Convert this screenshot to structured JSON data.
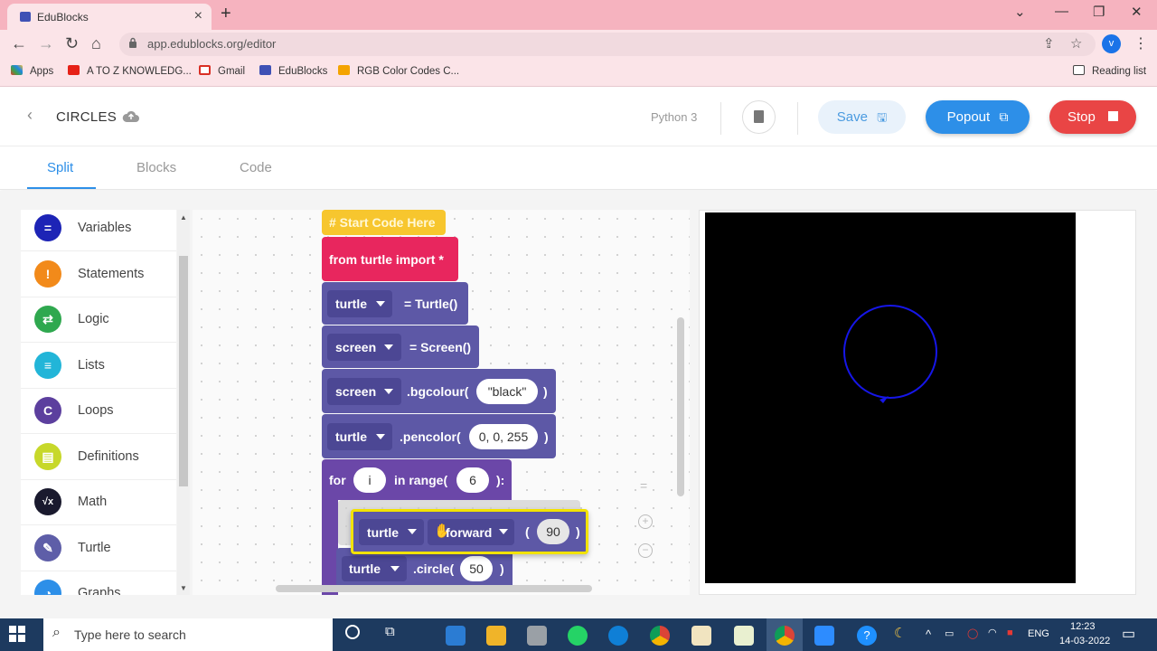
{
  "browser": {
    "tab_title": "EduBlocks",
    "url": "app.edublocks.org/editor",
    "avatar_letter": "v",
    "bookmarks": [
      "Apps",
      "A TO Z KNOWLEDG...",
      "Gmail",
      "EduBlocks",
      "RGB Color Codes C..."
    ],
    "reading_list": "Reading list"
  },
  "header": {
    "project_title": "CIRCLES",
    "language": "Python 3",
    "save_label": "Save",
    "popout_label": "Popout",
    "stop_label": "Stop"
  },
  "view_tabs": [
    "Split",
    "Blocks",
    "Code"
  ],
  "categories": [
    {
      "label": "Variables",
      "color": "#1d24b6",
      "glyph": "="
    },
    {
      "label": "Statements",
      "color": "#f28a1a",
      "glyph": "!"
    },
    {
      "label": "Logic",
      "color": "#2fa84f",
      "glyph": "⇄"
    },
    {
      "label": "Lists",
      "color": "#22b5d8",
      "glyph": "≡"
    },
    {
      "label": "Loops",
      "color": "#5c3f9e",
      "glyph": "C"
    },
    {
      "label": "Definitions",
      "color": "#c7d82a",
      "glyph": "▤"
    },
    {
      "label": "Math",
      "color": "#1a1a2e",
      "glyph": "√x"
    },
    {
      "label": "Turtle",
      "color": "#5e5ea8",
      "glyph": "✎"
    },
    {
      "label": "Graphs",
      "color": "#2d8fe8",
      "glyph": "◔"
    }
  ],
  "blocks": {
    "start": "# Start Code Here",
    "import": "from turtle import *",
    "turtle_var": "turtle",
    "turtle_assign": "= Turtle()",
    "screen_var": "screen",
    "screen_assign": "= Screen()",
    "bgcolour_call": ".bgcolour(",
    "bgcolour_value": "\"black\"",
    "pencolor_call": ".pencolor(",
    "pencolor_value": "0, 0, 255",
    "close_paren": ")",
    "for_kw": "for",
    "for_var": "i",
    "in_range": "in range(",
    "range_value": "6",
    "range_close": "):",
    "forward_method": "forward",
    "open_paren": "(",
    "forward_value": "90",
    "circle_call": ".circle(",
    "circle_value": "50"
  },
  "output": {
    "background": "#000000",
    "pen_color": "#0000ff"
  },
  "taskbar": {
    "search_placeholder": "Type here to search",
    "language": "ENG",
    "time": "12:23",
    "date": "14-03-2022"
  }
}
